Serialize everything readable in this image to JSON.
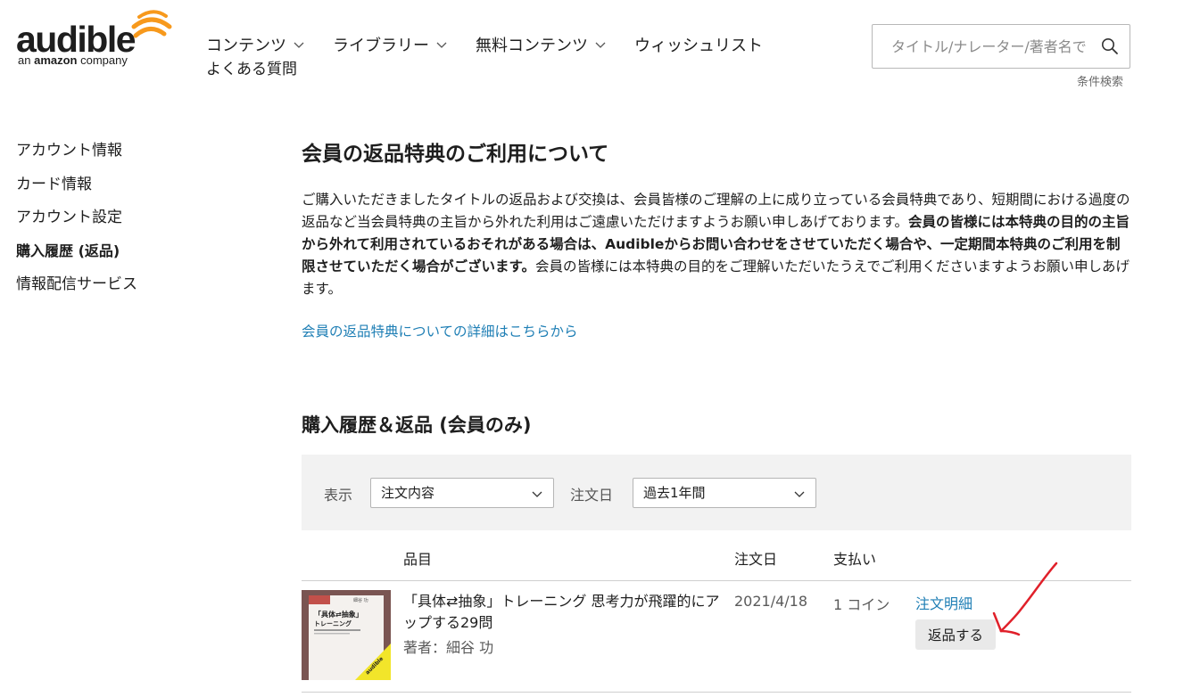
{
  "brand": {
    "wordmark": "audible",
    "tagline_prefix": "an",
    "tagline_brand": "amazon",
    "tagline_suffix": "company",
    "accent_color": "#f7991c"
  },
  "nav": {
    "items": [
      {
        "label": "コンテンツ",
        "has_dropdown": true
      },
      {
        "label": "ライブラリー",
        "has_dropdown": true
      },
      {
        "label": "無料コンテンツ",
        "has_dropdown": true
      },
      {
        "label": "ウィッシュリスト",
        "has_dropdown": false
      }
    ],
    "faq_label": "よくある質問"
  },
  "search": {
    "placeholder": "タイトル/ナレーター/著者名で",
    "icon": "search-icon",
    "advanced_label": "条件検索"
  },
  "sidebar": {
    "items": [
      {
        "label": "アカウント情報",
        "active": false
      },
      {
        "label": "カード情報",
        "active": false
      },
      {
        "label": "アカウント設定",
        "active": false
      },
      {
        "label": "購入履歴 (返品)",
        "active": true
      },
      {
        "label": "情報配信サービス",
        "active": false
      }
    ]
  },
  "main": {
    "title": "会員の返品特典のご利用について",
    "paragraph": {
      "part1": "ご購入いただきましたタイトルの返品および交換は、会員皆様のご理解の上に成り立っている会員特典であり、短期間における過度の返品など当会員特典の主旨から外れた利用はご遠慮いただけますようお願い申しあげております。",
      "bold": "会員の皆様には本特典の目的の主旨から外れて利用されているおそれがある場合は、Audibleからお問い合わせをさせていただく場合や、一定期間本特典のご利用を制限させていただく場合がございます。",
      "part2": "会員の皆様には本特典の目的をご理解いただいたうえでご利用くださいますようお願い申しあげます。"
    },
    "detail_link": "会員の返品特典についての詳細はこちらから",
    "history_title": "購入履歴＆返品 (会員のみ)"
  },
  "filters": {
    "display_label": "表示",
    "display_value": "注文内容",
    "date_label": "注文日",
    "date_value": "過去1年間"
  },
  "table": {
    "headers": {
      "item": "品目",
      "date": "注文日",
      "payment": "支払い"
    },
    "rows": [
      {
        "title": "「具体⇄抽象」トレーニング 思考力が飛躍的にアップする29問",
        "author": "著者：細谷 功",
        "date": "2021/4/18",
        "payment": "1 コイン",
        "order_link": "注文明細",
        "return_label": "返品する",
        "cover": {
          "title_line1": "「具体⇄抽象」",
          "title_line2": "トレーニング",
          "author": "細谷 功",
          "badge": "audible"
        }
      }
    ]
  },
  "annotation": {
    "arrow_color": "#e0202a"
  }
}
